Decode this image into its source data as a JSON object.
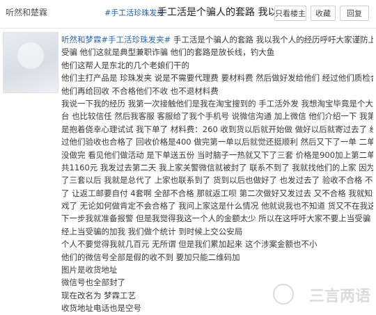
{
  "header": {
    "username": "听然和楚霖",
    "tag": "#手工活珍珠发夹",
    "title": "手工活是个骗人的套路 我以...",
    "buttons": {
      "only_op": "只看楼主",
      "favorite": "收藏",
      "reply": "回复"
    }
  },
  "post": {
    "lines": [
      {
        "hash": "听然和梦霖#手工活珍珠发夹#",
        "text": " 手工活是个骗人的套路 我以我个人的经历呼吁大家谨防上当"
      },
      {
        "text": "受骗 他们这就是典型兼职诈骗 他们的套路是放长线，钓大鱼"
      },
      {
        "text": "他们这帮人是东北的几个老娘们干的"
      },
      {
        "text": "他们主打产品是 珍珠发夹 说是不需要代理费 要材料费 然后做好发给他们 经过他们质检合格后"
      },
      {
        "text": "他们再给回收 不合格他们不收 也不退材料费"
      },
      {
        "text": "我说一下我的经历 我第一次接触他们是我在淘宝搜到的 手工活外发 我想淘宝毕竟是个大平"
      },
      {
        "text": "台 也比较信任 然后我客服 客服给了我个手机号 说微信沟通 加上微信 他们介绍一下 我第一单也"
      },
      {
        "text": "是抱着侥幸心理试试 我下单了 材料费：260 收到货以后就开始做 做好以后就寄过去了 经"
      },
      {
        "text": "过他们验收也合格了 回收价格是400 做完第一单以后就觉还挺顺利 然后又下了一单 二单还"
      },
      {
        "text": "没做完 看见他们做活动 是下单送五份 当时脑子一热就又下了三套 价格是900加上第二单一"
      },
      {
        "text": "共1160元 我发过去第二天 我上家关警微信就被封了 联系不到了 我就找他们的上家 因为我下"
      },
      {
        "text": "了三套以后 我就是总代了 上家也联系到了 货到以后也做好了 也发过去了 验收不合格 不收"
      },
      {
        "text": "了 让返工邮要自付 4套啊 全部不合格 那就返工呗 第二次做好又发过去 又不合格 我就知道没"
      },
      {
        "text": "戏了 无论如何做肯定不会合格了 我问上家这是什么情况 他就说我也不知道 货又不在我这"
      },
      {
        "text": "下一步我就准备报警 但是我觉得我这一个人的金额太少 所以在这呼吁大家不要上当受骗 已"
      },
      {
        "text": "经上当受骗的加我 我们做个统计 到时候上交公安局"
      },
      {
        "text": "个人不要觉得我就几百元 无所谓 但是我们累加起来 这个涉案金额也不小"
      },
      {
        "text": "他们的微信号全部是假的收不到 要加只能二维码加"
      },
      {
        "text": "图片是收货地址"
      },
      {
        "text": "微信号也全部封了"
      },
      {
        "text": "现在改名为 梦霖工艺"
      },
      {
        "text": "收货地址电话也是空号"
      }
    ]
  },
  "watermark": "三言两语"
}
